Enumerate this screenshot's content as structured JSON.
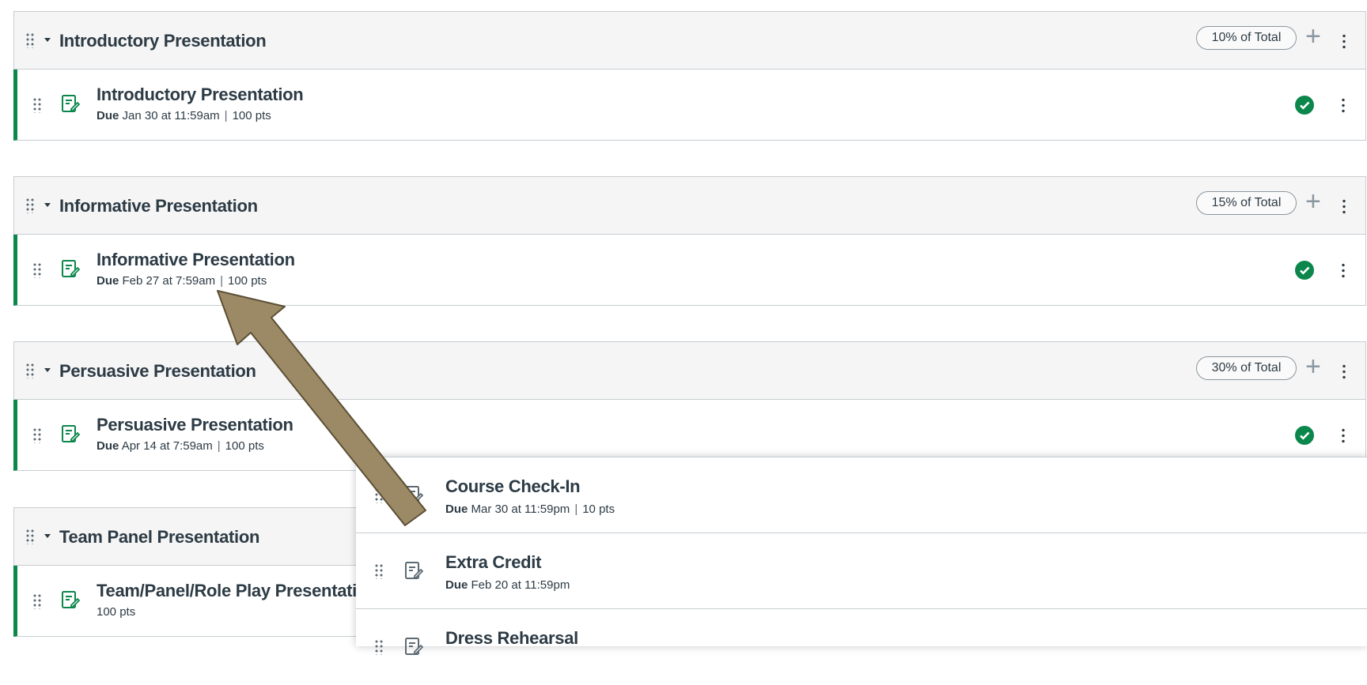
{
  "colors": {
    "accent": "#0b874b",
    "text": "#2d3b45",
    "header_bg": "#f5f5f5",
    "border": "#c7cdd1",
    "arrow": "#9c8a66"
  },
  "groups": [
    {
      "title": "Introductory Presentation",
      "weight": "10% of Total",
      "item": {
        "title": "Introductory Presentation",
        "due_label": "Due",
        "due": "Jan 30 at 11:59am",
        "sep": "|",
        "points": "100 pts",
        "published": true
      }
    },
    {
      "title": "Informative Presentation",
      "weight": "15% of Total",
      "item": {
        "title": "Informative Presentation",
        "due_label": "Due",
        "due": "Feb 27 at 7:59am",
        "sep": "|",
        "points": "100 pts",
        "published": true
      }
    },
    {
      "title": "Persuasive Presentation",
      "weight": "30% of Total",
      "item": {
        "title": "Persuasive Presentation",
        "due_label": "Due",
        "due": "Apr 14 at 7:59am",
        "sep": "|",
        "points": "100 pts",
        "published": true
      }
    },
    {
      "title": "Team Panel Presentation",
      "item": {
        "title": "Team/Panel/Role Play Presentation",
        "points": "100 pts"
      }
    }
  ],
  "panel_items": [
    {
      "title": "Course Check-In",
      "due_label": "Due",
      "due": "Mar 30 at 11:59pm",
      "sep": "|",
      "points": "10 pts"
    },
    {
      "title": "Extra Credit",
      "due_label": "Due",
      "due": "Feb 20 at 11:59pm"
    },
    {
      "title": "Dress Rehearsal"
    }
  ],
  "icons": {
    "drag": "drag-handle-icon",
    "caret": "caret-down-icon",
    "assignment": "assignment-icon",
    "plus": "plus-icon",
    "kebab": "kebab-menu-icon",
    "check": "published-check-icon"
  }
}
